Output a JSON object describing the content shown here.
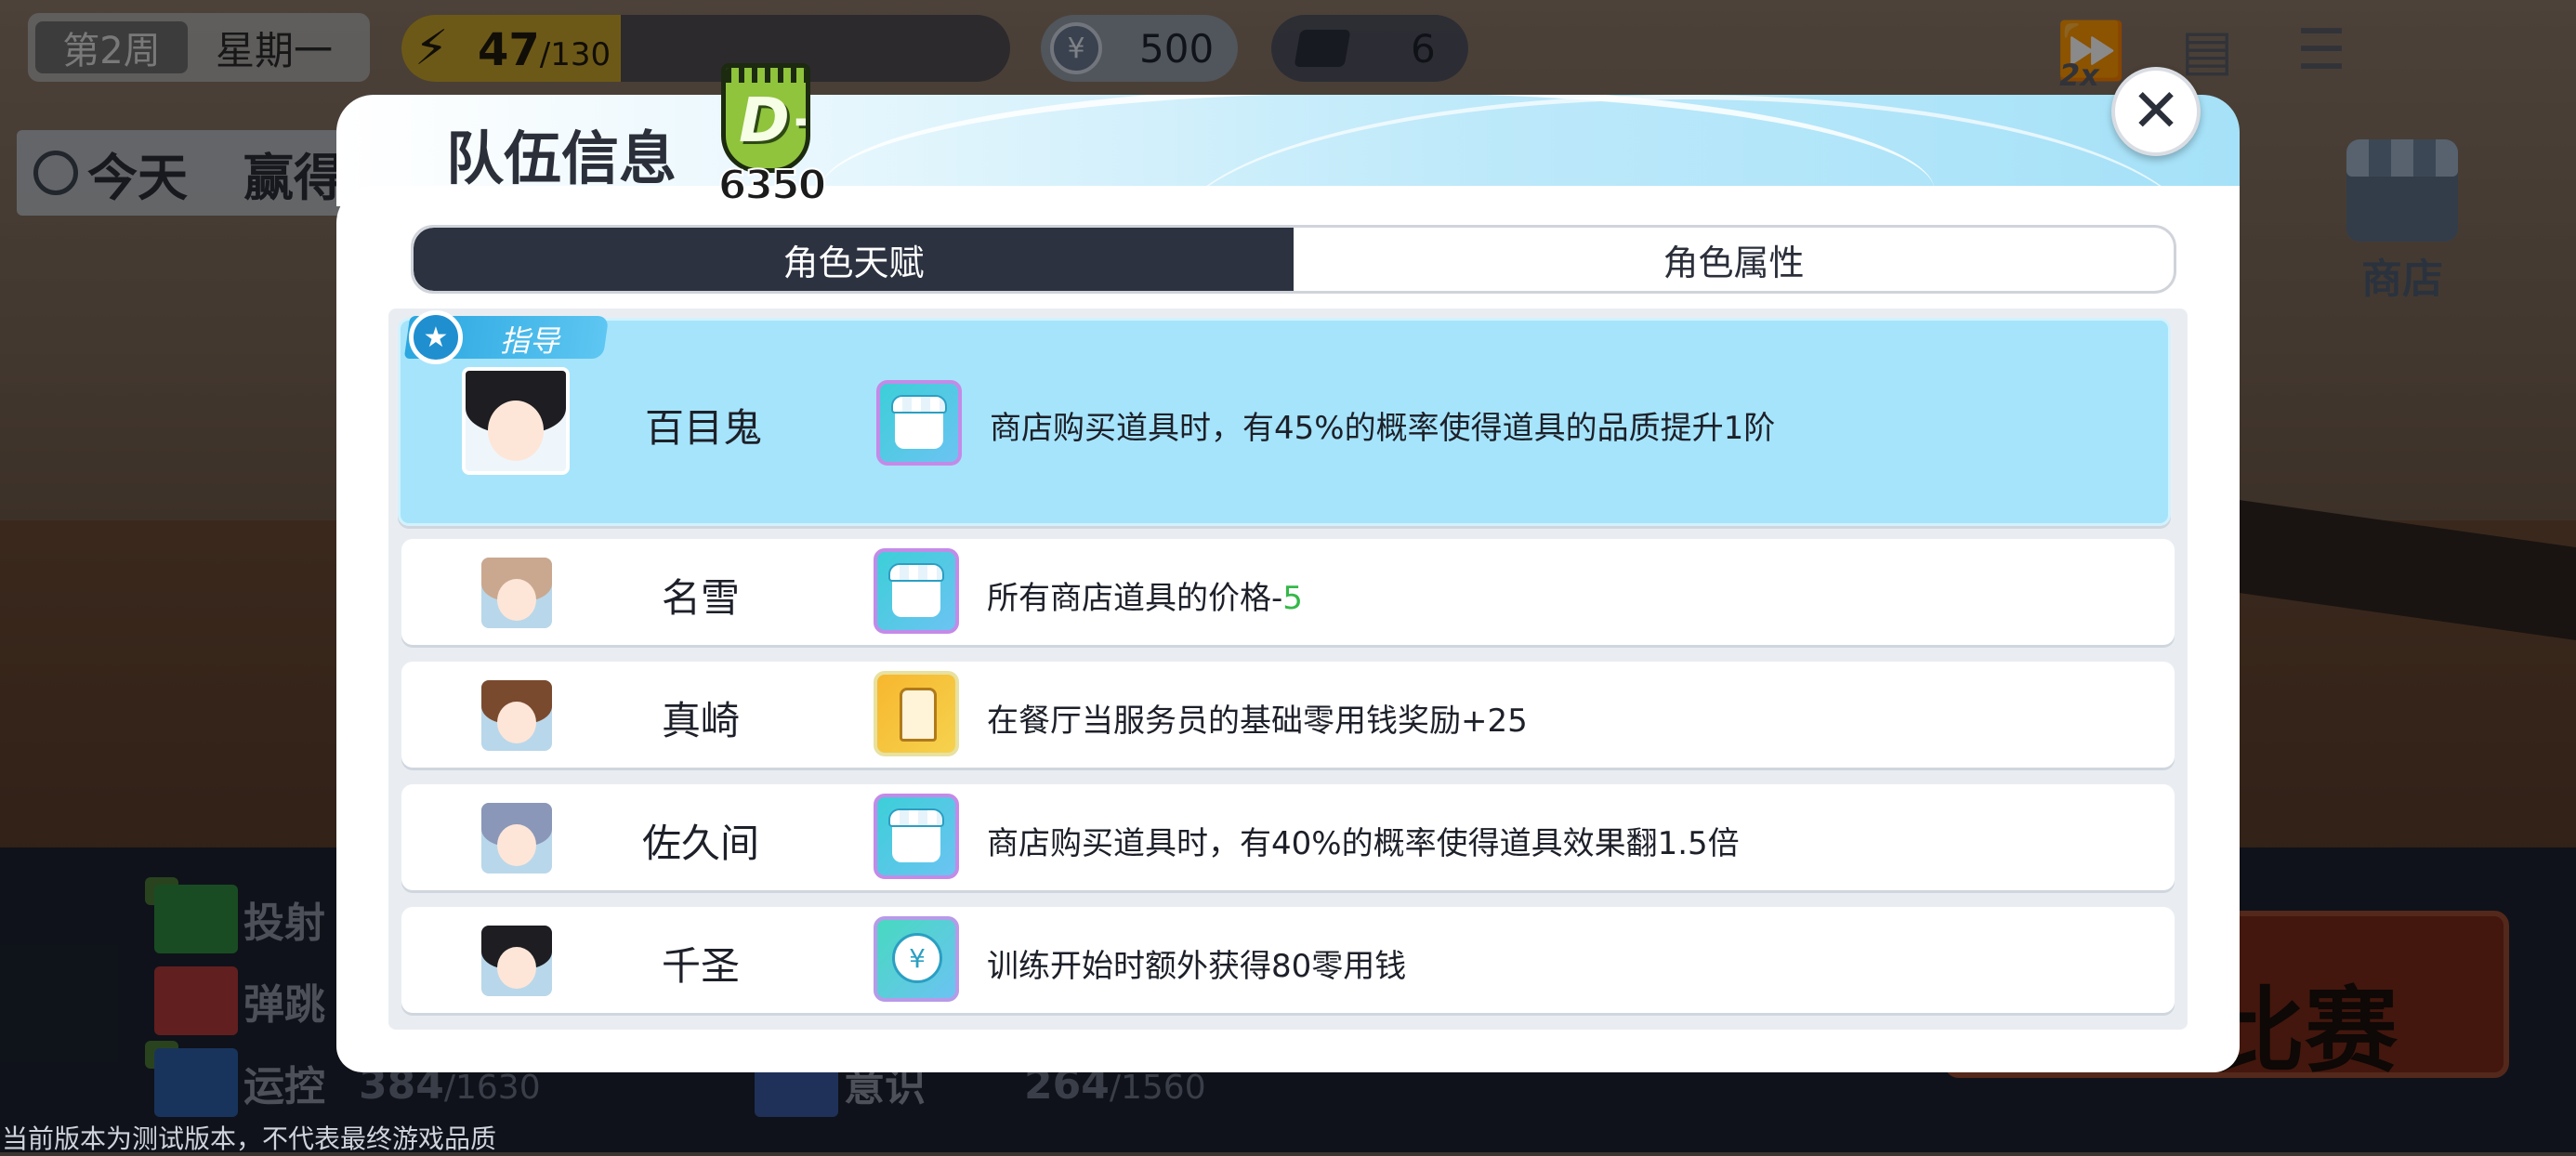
{
  "hud": {
    "week_label": "第2周",
    "weekday": "星期一",
    "energy_value": "47",
    "energy_max": "/130",
    "energy_fill_fraction": 0.36,
    "coin_value": "500",
    "ticket_value": "6",
    "speed_label": "2x"
  },
  "today": {
    "label": "今天",
    "goal_partial": "赢得"
  },
  "shop": {
    "label": "商店"
  },
  "stats": [
    {
      "label": "投射"
    },
    {
      "label": "弹跳"
    },
    {
      "label": "运控",
      "value": "384",
      "max": "/1630"
    },
    {
      "label": "意识",
      "value": "264",
      "max": "/1560"
    }
  ],
  "match_button_label": "比赛",
  "version_note": "当前版本为测试版本，不代表最终游戏品质",
  "dialog": {
    "title": "队伍信息",
    "rank_letter": "D+",
    "rank_score": "6350",
    "close_symbol": "✕",
    "tabs": [
      {
        "label": "角色天赋",
        "active": true
      },
      {
        "label": "角色属性",
        "active": false
      }
    ],
    "mentor_tag": "指导",
    "rows": [
      {
        "name": "百目鬼",
        "talent_icon": "shop-icon",
        "desc": "商店购买道具时，有45%的概率使得道具的品质提升1阶",
        "desc_suffix": "",
        "mentor": true
      },
      {
        "name": "名雪",
        "talent_icon": "shop-icon",
        "desc": "所有商店道具的价格-",
        "desc_suffix": "5",
        "mentor": false
      },
      {
        "name": "真崎",
        "talent_icon": "vest-icon",
        "desc": "在餐厅当服务员的基础零用钱奖励+25",
        "desc_suffix": "",
        "mentor": false
      },
      {
        "name": "佐久间",
        "talent_icon": "shop-icon",
        "desc": "商店购买道具时，有40%的概率使得道具效果翻1.5倍",
        "desc_suffix": "",
        "mentor": false
      },
      {
        "name": "千圣",
        "talent_icon": "coin-icon",
        "desc": "训练开始时额外获得80零用钱",
        "desc_suffix": "",
        "mentor": false
      }
    ]
  },
  "colors": {
    "mentor_row": "#a6e4fb",
    "active_tab": "#2c3240",
    "price_reduction": "#35b84a",
    "rank_badge": "#8fc43c"
  }
}
